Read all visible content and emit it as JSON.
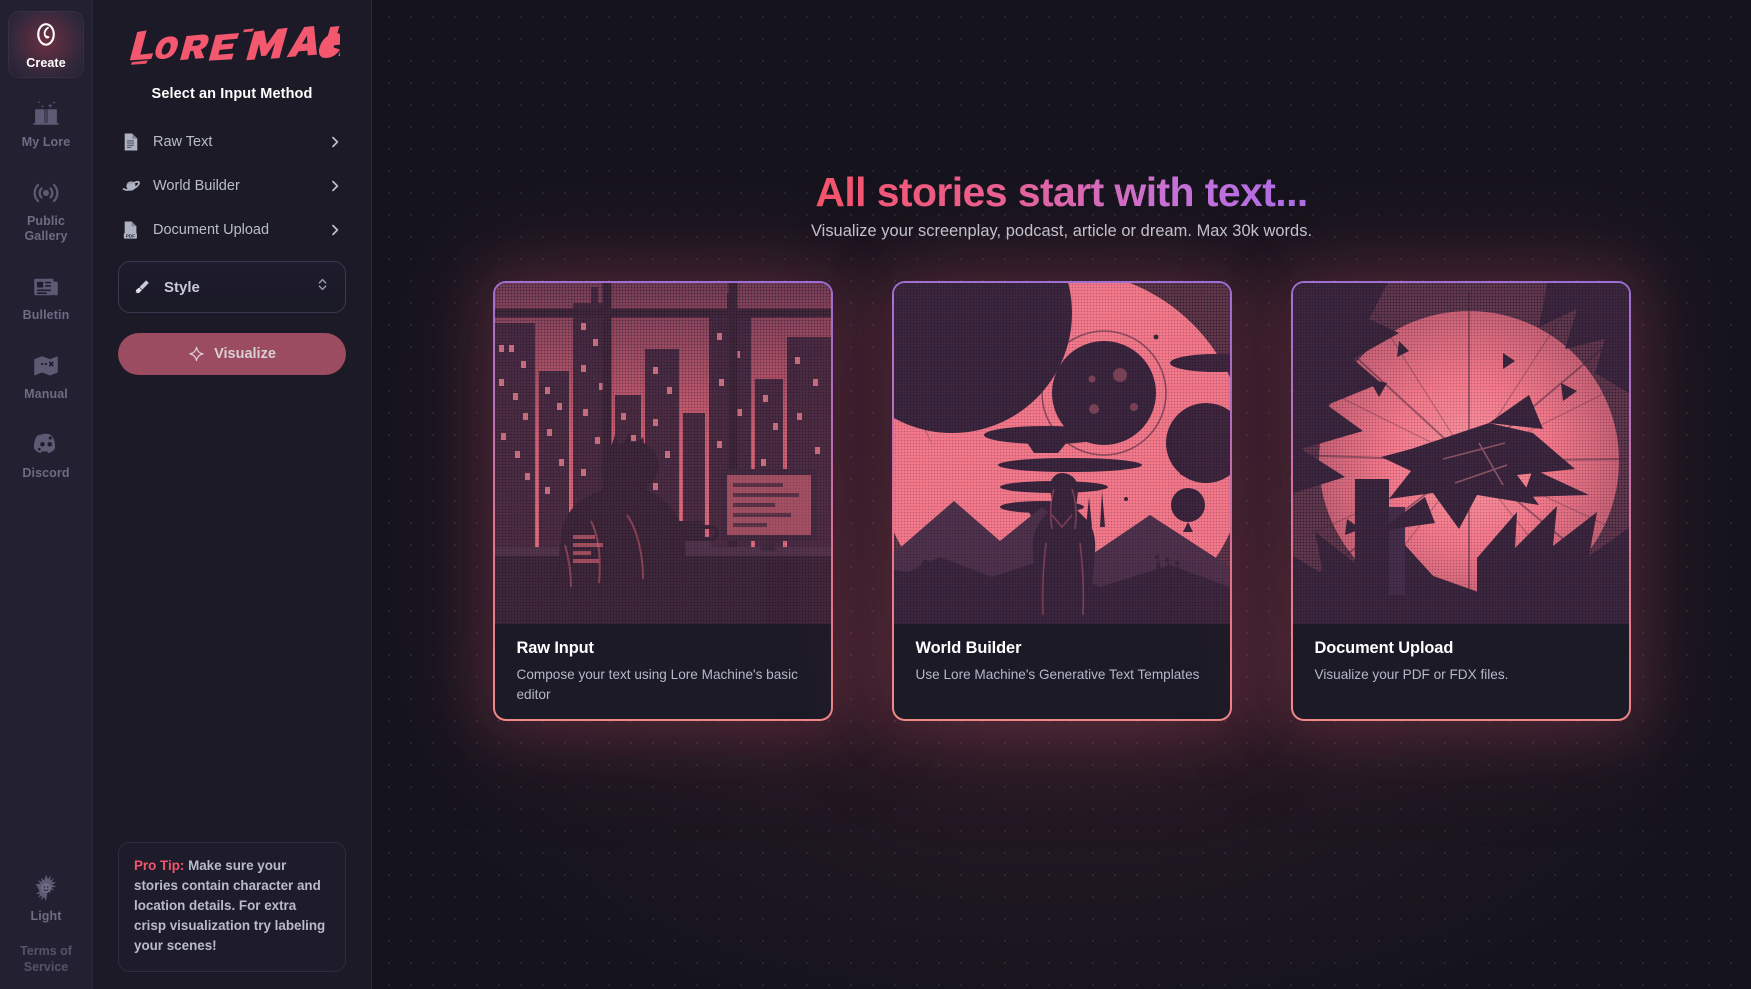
{
  "rail": {
    "items": [
      {
        "label": "Create",
        "icon": "create-swirl-icon",
        "active": true
      },
      {
        "label": "My Lore",
        "icon": "open-book-icon",
        "active": false
      },
      {
        "label": "Public Gallery",
        "icon": "broadcast-icon",
        "active": false
      },
      {
        "label": "Bulletin",
        "icon": "newspaper-icon",
        "active": false
      },
      {
        "label": "Manual",
        "icon": "map-icon",
        "active": false
      },
      {
        "label": "Discord",
        "icon": "discord-icon",
        "active": false
      }
    ],
    "theme_toggle": {
      "label": "Light",
      "icon": "sun-icon"
    },
    "terms_label": "Terms of\nService"
  },
  "sidebar": {
    "logo_text": "Lore Machine",
    "title": "Select an Input Method",
    "methods": [
      {
        "label": "Raw Text",
        "icon": "document-text-icon",
        "chevron": "chevron-right-icon"
      },
      {
        "label": "World Builder",
        "icon": "planet-icon",
        "chevron": "chevron-right-icon"
      },
      {
        "label": "Document Upload",
        "icon": "pdf-file-icon",
        "chevron": "chevron-right-icon"
      }
    ],
    "style_select": {
      "label": "Style",
      "icon": "paintbrush-icon",
      "chevron": "chevron-updown-icon"
    },
    "visualize_button": {
      "label": "Visualize",
      "icon": "sparkle-icon"
    },
    "pro_tip": {
      "lead": "Pro Tip:",
      "body": " Make sure your stories contain character and location details. For extra crisp visualization try labeling your scenes!"
    }
  },
  "main": {
    "headline": "All stories start with text...",
    "subheadline": "Visualize your screenplay, podcast, article or dream. Max 30k words.",
    "cards": [
      {
        "title": "Raw Input",
        "description": "Compose your text using Lore Machine's basic editor",
        "art": "cyberpunk-writer-at-desk"
      },
      {
        "title": "World Builder",
        "description": "Use Lore Machine's Generative Text Templates",
        "art": "figure-on-alien-planet"
      },
      {
        "title": "Document Upload",
        "description": "Visualize your PDF or FDX files.",
        "art": "exploding-spacecraft"
      }
    ]
  },
  "colors": {
    "accent_pink": "#f2556e",
    "accent_purple": "#ab6ee8",
    "rail_bg": "#222031",
    "panel_bg": "#1b1a26",
    "main_bg": "#15141d",
    "button_rose": "#9c4c60",
    "art_salmon": "#f07080",
    "art_dark": "#241f33"
  }
}
